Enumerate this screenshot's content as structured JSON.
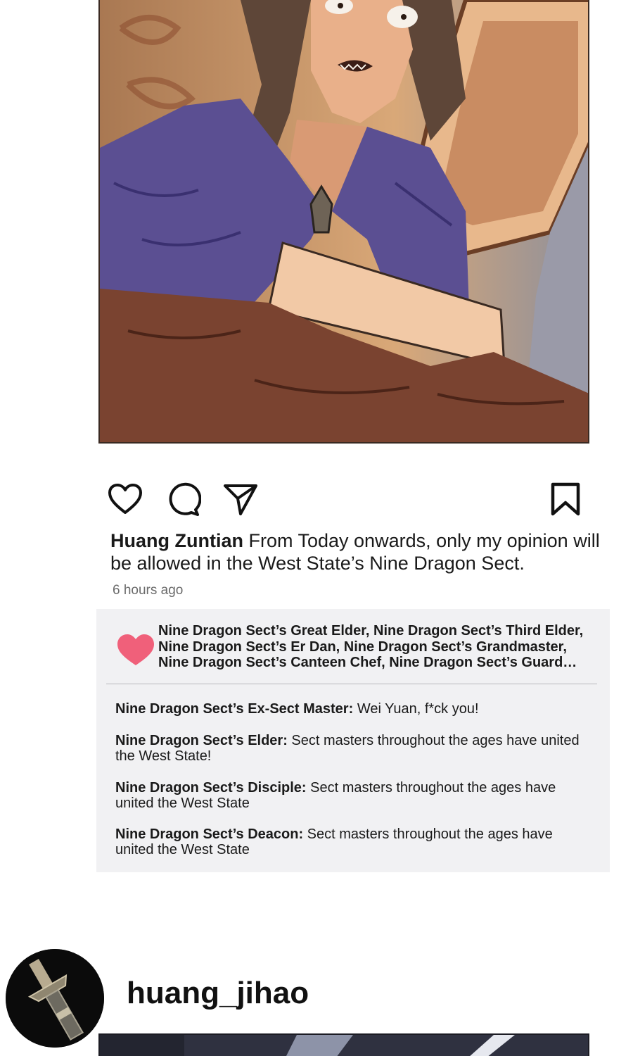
{
  "post": {
    "username": "Huang Zuntian",
    "caption": " From Today onwards, only my opinion will be allowed in the West State’s Nine Dragon Sect.",
    "timestamp": "6 hours ago",
    "icons": [
      "heart-icon",
      "comment-icon",
      "share-icon",
      "bookmark-icon"
    ]
  },
  "likes": {
    "lines": [
      "Nine Dragon Sect’s Great Elder, Nine Dragon Sect’s Third Elder,",
      "Nine Dragon Sect’s Er Dan, Nine Dragon Sect’s Grandmaster,",
      "Nine Dragon Sect’s Canteen Chef, Nine Dragon Sect’s Guard…"
    ]
  },
  "comments": [
    {
      "author": "Nine Dragon Sect’s Ex-Sect Master:",
      "text": " Wei Yuan, f*ck you!"
    },
    {
      "author": "Nine Dragon Sect’s Elder:",
      "text": " Sect masters throughout the ages have united the West State!"
    },
    {
      "author": "Nine Dragon Sect’s Disciple:",
      "text": " Sect masters throughout the ages have united the West State"
    },
    {
      "author": "Nine Dragon Sect’s Deacon:",
      "text": " Sect masters throughout the ages have united the West State"
    }
  ],
  "next_post": {
    "username": "huang_jihao"
  },
  "colors": {
    "heart": "#f0607a",
    "panel": "#f1f1f3",
    "cloak": "#5b4f92",
    "robe": "#7a4330"
  }
}
